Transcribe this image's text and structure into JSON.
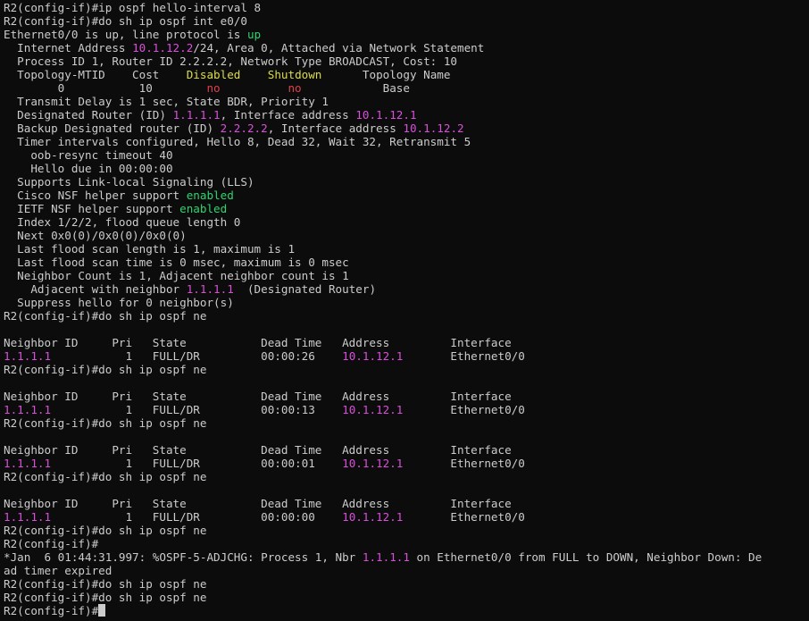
{
  "window": {
    "type": "terminal"
  },
  "colors": {
    "default": "#cccccc",
    "ip": "#d94fdb",
    "yellow": "#dcdc4c",
    "red": "#e0404a",
    "green": "#2fd46f",
    "background": "#0c0c0c"
  },
  "terminal": {
    "lines": [
      [
        [
          "R2(config-if)#ip ospf hello-interval 8",
          "default"
        ]
      ],
      [
        [
          "R2(config-if)#do sh ip ospf int e0/0",
          "default"
        ]
      ],
      [
        [
          "Ethernet0/0 is up, line protocol is ",
          "default"
        ],
        [
          "up",
          "green"
        ]
      ],
      [
        [
          "  Internet Address ",
          "default"
        ],
        [
          "10.1.12.2",
          "ip"
        ],
        [
          "/24, Area 0, Attached via Network Statement",
          "default"
        ]
      ],
      [
        [
          "  Process ID 1, Router ID 2.2.2.2, Network Type BROADCAST, Cost: 10",
          "default"
        ]
      ],
      [
        [
          "  Topology-MTID    Cost    ",
          "default"
        ],
        [
          "Disabled",
          "yellow"
        ],
        [
          "    ",
          "default"
        ],
        [
          "Shutdown",
          "yellow"
        ],
        [
          "      Topology Name",
          "default"
        ]
      ],
      [
        [
          "        0           10        ",
          "default"
        ],
        [
          "no",
          "red"
        ],
        [
          "          ",
          "default"
        ],
        [
          "no",
          "red"
        ],
        [
          "            Base",
          "default"
        ]
      ],
      [
        [
          "  Transmit Delay is 1 sec, State BDR, Priority 1",
          "default"
        ]
      ],
      [
        [
          "  Designated Router (ID) ",
          "default"
        ],
        [
          "1.1.1.1",
          "ip"
        ],
        [
          ", Interface address ",
          "default"
        ],
        [
          "10.1.12.1",
          "ip"
        ]
      ],
      [
        [
          "  Backup Designated router (ID) ",
          "default"
        ],
        [
          "2.2.2.2",
          "ip"
        ],
        [
          ", Interface address ",
          "default"
        ],
        [
          "10.1.12.2",
          "ip"
        ]
      ],
      [
        [
          "  Timer intervals configured, Hello 8, Dead 32, Wait 32, Retransmit 5",
          "default"
        ]
      ],
      [
        [
          "    oob-resync timeout 40",
          "default"
        ]
      ],
      [
        [
          "    Hello due in 00:00:00",
          "default"
        ]
      ],
      [
        [
          "  Supports Link-local Signaling (LLS)",
          "default"
        ]
      ],
      [
        [
          "  Cisco NSF helper support ",
          "default"
        ],
        [
          "enabled",
          "green"
        ]
      ],
      [
        [
          "  IETF NSF helper support ",
          "default"
        ],
        [
          "enabled",
          "green"
        ]
      ],
      [
        [
          "  Index 1/2/2, flood queue length 0",
          "default"
        ]
      ],
      [
        [
          "  Next 0x0(0)/0x0(0)/0x0(0)",
          "default"
        ]
      ],
      [
        [
          "  Last flood scan length is 1, maximum is 1",
          "default"
        ]
      ],
      [
        [
          "  Last flood scan time is 0 msec, maximum is 0 msec",
          "default"
        ]
      ],
      [
        [
          "  Neighbor Count is 1, Adjacent neighbor count is 1",
          "default"
        ]
      ],
      [
        [
          "    Adjacent with neighbor ",
          "default"
        ],
        [
          "1.1.1.1",
          "ip"
        ],
        [
          "  (Designated Router)",
          "default"
        ]
      ],
      [
        [
          "  Suppress hello for 0 neighbor(s)",
          "default"
        ]
      ],
      [
        [
          "R2(config-if)#do sh ip ospf ne",
          "default"
        ]
      ],
      [
        [
          "",
          "default"
        ]
      ],
      [
        [
          "Neighbor ID     Pri   State           Dead Time   Address         Interface",
          "default"
        ]
      ],
      [
        [
          "1.1.1.1",
          "ip"
        ],
        [
          "           1   FULL/DR         00:00:26    ",
          "default"
        ],
        [
          "10.1.12.1",
          "ip"
        ],
        [
          "       Ethernet0/0",
          "default"
        ]
      ],
      [
        [
          "R2(config-if)#do sh ip ospf ne",
          "default"
        ]
      ],
      [
        [
          "",
          "default"
        ]
      ],
      [
        [
          "Neighbor ID     Pri   State           Dead Time   Address         Interface",
          "default"
        ]
      ],
      [
        [
          "1.1.1.1",
          "ip"
        ],
        [
          "           1   FULL/DR         00:00:13    ",
          "default"
        ],
        [
          "10.1.12.1",
          "ip"
        ],
        [
          "       Ethernet0/0",
          "default"
        ]
      ],
      [
        [
          "R2(config-if)#do sh ip ospf ne",
          "default"
        ]
      ],
      [
        [
          "",
          "default"
        ]
      ],
      [
        [
          "Neighbor ID     Pri   State           Dead Time   Address         Interface",
          "default"
        ]
      ],
      [
        [
          "1.1.1.1",
          "ip"
        ],
        [
          "           1   FULL/DR         00:00:01    ",
          "default"
        ],
        [
          "10.1.12.1",
          "ip"
        ],
        [
          "       Ethernet0/0",
          "default"
        ]
      ],
      [
        [
          "R2(config-if)#do sh ip ospf ne",
          "default"
        ]
      ],
      [
        [
          "",
          "default"
        ]
      ],
      [
        [
          "Neighbor ID     Pri   State           Dead Time   Address         Interface",
          "default"
        ]
      ],
      [
        [
          "1.1.1.1",
          "ip"
        ],
        [
          "           1   FULL/DR         00:00:00    ",
          "default"
        ],
        [
          "10.1.12.1",
          "ip"
        ],
        [
          "       Ethernet0/0",
          "default"
        ]
      ],
      [
        [
          "R2(config-if)#do sh ip ospf ne",
          "default"
        ]
      ],
      [
        [
          "R2(config-if)#",
          "default"
        ]
      ],
      [
        [
          "*Jan  6 01:44:31.997: %OSPF-5-ADJCHG: Process 1, Nbr ",
          "default"
        ],
        [
          "1.1.1.1",
          "ip"
        ],
        [
          " on Ethernet0/0 from FULL to DOWN, Neighbor Down: De",
          "default"
        ]
      ],
      [
        [
          "ad timer expired",
          "default"
        ]
      ],
      [
        [
          "R2(config-if)#do sh ip ospf ne",
          "default"
        ]
      ],
      [
        [
          "R2(config-if)#do sh ip ospf ne",
          "default"
        ]
      ]
    ],
    "prompt": "R2(config-if)#"
  }
}
